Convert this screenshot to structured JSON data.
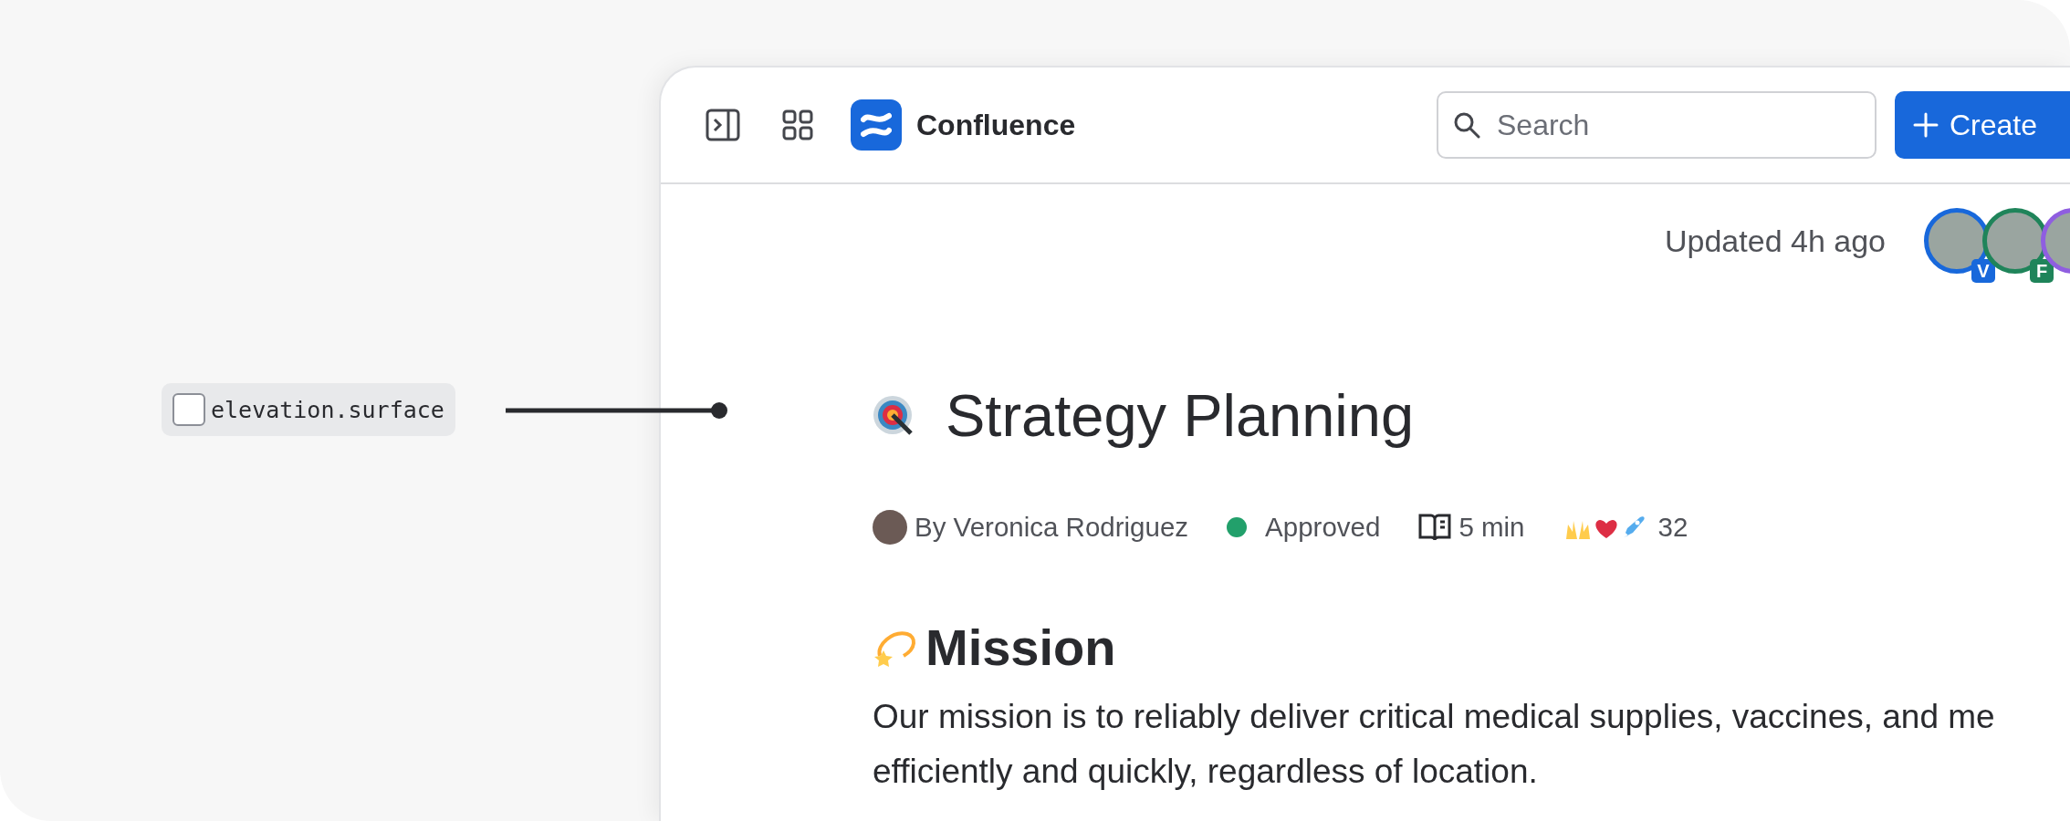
{
  "annotation": {
    "token": "elevation.surface"
  },
  "header": {
    "product": "Confluence",
    "search": {
      "placeholder": "Search"
    },
    "create_button": "Create"
  },
  "page": {
    "updated": "Updated 4h ago",
    "collaborators": [
      {
        "badge": "V",
        "color": "#1868db"
      },
      {
        "badge": "F",
        "color": "#1f845a"
      },
      {
        "color": "#8f5ee0"
      }
    ],
    "title": "Strategy Planning",
    "author": "By Veronica Rodriguez",
    "status": "Approved",
    "read_time": "5 min",
    "reaction_count": "32",
    "heading": "Mission",
    "paragraph_lines": [
      "Our mission is to reliably deliver critical medical supplies, vaccines, and me",
      "efficiently and quickly, regardless of location."
    ]
  }
}
